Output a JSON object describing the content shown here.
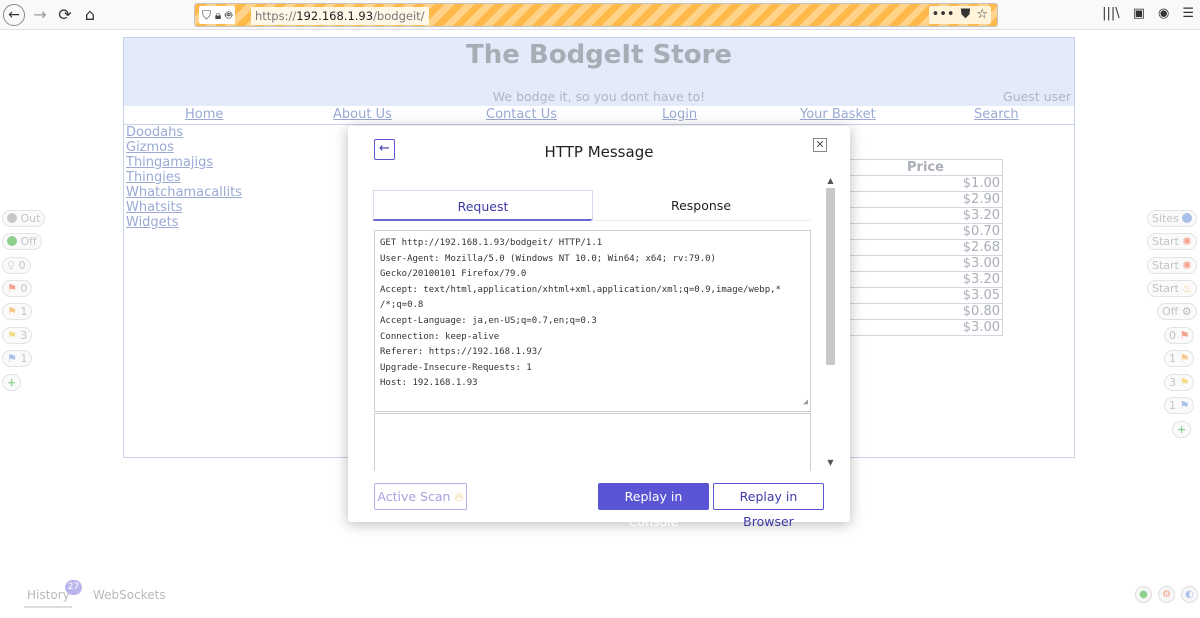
{
  "browser": {
    "back_glyph": "←",
    "forward_glyph": "→",
    "reload_glyph": "⟳",
    "home_glyph": "⌂",
    "url_prefix": "https://",
    "url_host": "192.168.1.93",
    "url_path": "/bodgeit/",
    "url_icons": "⛉ 🔒︎ 🤖︎",
    "url_menu": "•••",
    "pocket_icon": "⛊",
    "bookmark_icon": "☆",
    "library_icon": "|||\\",
    "sidebar_icon": "▣",
    "account_icon": "◉",
    "menu_icon": "☰"
  },
  "store": {
    "title": "The BodgeIt Store",
    "tagline": "We bodge it, so you dont have to!",
    "user": "Guest user",
    "nav": [
      "Home",
      "About Us",
      "Contact Us",
      "Login",
      "Your Basket",
      "Search"
    ],
    "categories": [
      "Doodahs",
      "Gizmos",
      "Thingamajigs",
      "Thingies",
      "Whatchamacallits",
      "Whatsits",
      "Widgets"
    ],
    "price_header": "Price",
    "prices": [
      "$1.00",
      "$2.90",
      "$3.20",
      "$0.70",
      "$2.68",
      "$3.00",
      "$3.20",
      "$3.05",
      "$0.80",
      "$3.00"
    ]
  },
  "hud_left": [
    {
      "label": "Out",
      "icon": "status-dot"
    },
    {
      "label": "Off",
      "icon": "status-dot"
    },
    {
      "label": "0",
      "icon": "bulb"
    },
    {
      "label": "0",
      "icon": "flag"
    },
    {
      "label": "1",
      "icon": "flag"
    },
    {
      "label": "3",
      "icon": "flag"
    },
    {
      "label": "1",
      "icon": "flag"
    },
    {
      "label": "+",
      "icon": "plus"
    }
  ],
  "hud_right": [
    {
      "label": "Sites",
      "icon": "globe"
    },
    {
      "label": "Start",
      "icon": "spider"
    },
    {
      "label": "Start",
      "icon": "spider"
    },
    {
      "label": "Start",
      "icon": "flame"
    },
    {
      "label": "Off",
      "icon": "gear"
    },
    {
      "label": "0",
      "icon": "flag"
    },
    {
      "label": "1",
      "icon": "flag"
    },
    {
      "label": "3",
      "icon": "flag"
    },
    {
      "label": "1",
      "icon": "flag"
    },
    {
      "label": "+",
      "icon": "plus"
    }
  ],
  "hud_colors": {
    "flag_red": "#f4a28c",
    "flag_orange": "#f7c98a",
    "flag_yellow": "#f3dc8b",
    "flag_blue": "#a9c1e8",
    "green": "#8fd08f",
    "grey": "#c8c8c8"
  },
  "modal": {
    "back_glyph": "←",
    "close_glyph": "✕",
    "title": "HTTP Message",
    "tabs": [
      "Request",
      "Response"
    ],
    "request_lines": [
      "GET http://192.168.1.93/bodgeit/ HTTP/1.1",
      "User-Agent: Mozilla/5.0 (Windows NT 10.0; Win64; x64; rv:79.0)",
      "Gecko/20100101 Firefox/79.0",
      "Accept: text/html,application/xhtml+xml,application/xml;q=0.9,image/webp,*",
      "/*;q=0.8",
      "Accept-Language: ja,en-US;q=0.7,en;q=0.3",
      "Connection: keep-alive",
      "Referer: https://192.168.1.93/",
      "Upgrade-Insecure-Requests: 1",
      "Host: 192.168.1.93"
    ],
    "active_scan_label": "Active Scan",
    "active_scan_icon": "🔥︎",
    "replay_console_label": "Replay in Console",
    "replay_browser_label": "Replay in Browser"
  },
  "bottom": {
    "history_label": "History",
    "history_count": "27",
    "websockets_label": "WebSockets"
  },
  "colors": {
    "accent": "#5a55d4",
    "store_header_bg": "#e3ebfb",
    "link": "#9aaad5"
  }
}
